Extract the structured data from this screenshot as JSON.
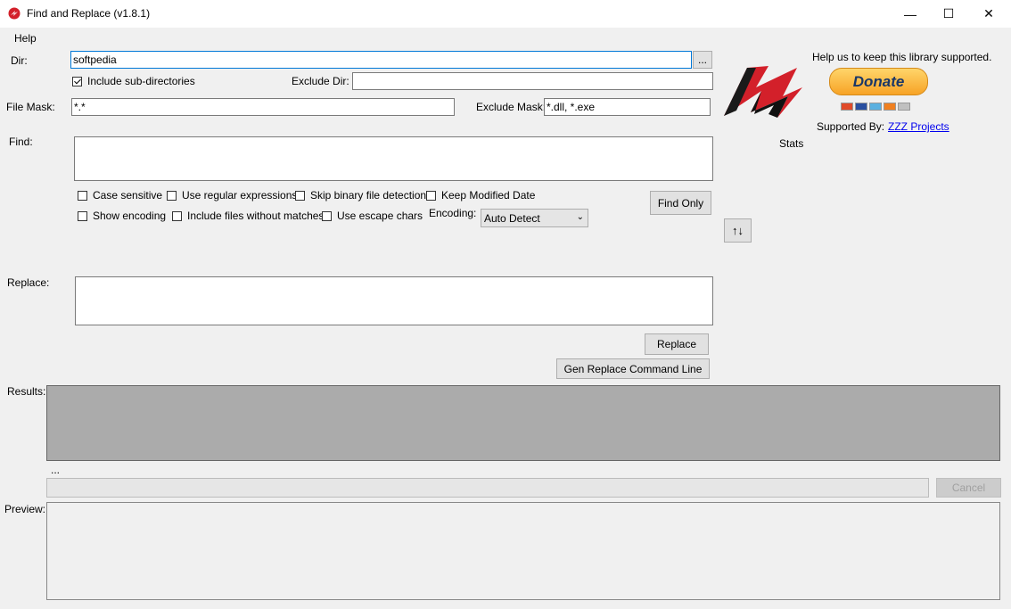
{
  "window": {
    "title": "Find and Replace (v1.8.1)",
    "controls": {
      "minimize": "—",
      "maximize": "☐",
      "close": "✕"
    }
  },
  "menu": {
    "items": [
      "Help"
    ]
  },
  "dir": {
    "label": "Dir:",
    "value": "softpedia",
    "browse_label": "..."
  },
  "include_subdirs": {
    "label": "Include sub-directories",
    "checked": true
  },
  "exclude_dir": {
    "label": "Exclude Dir:",
    "value": ""
  },
  "file_mask": {
    "label": "File Mask:",
    "value": "*.*"
  },
  "exclude_mask": {
    "label": "Exclude Mask:",
    "value": "*.dll, *.exe"
  },
  "find": {
    "label": "Find:",
    "value": ""
  },
  "options": {
    "case_sensitive": {
      "label": "Case sensitive",
      "checked": false
    },
    "regex": {
      "label": "Use regular expressions",
      "checked": false
    },
    "skip_binary": {
      "label": "Skip binary file detection",
      "checked": false
    },
    "keep_modified": {
      "label": "Keep Modified Date",
      "checked": false
    },
    "show_encoding": {
      "label": "Show encoding",
      "checked": false
    },
    "include_no_match": {
      "label": "Include files without matches",
      "checked": false
    },
    "escape_chars": {
      "label": "Use escape chars",
      "checked": false
    }
  },
  "encoding": {
    "label": "Encoding:",
    "selected": "Auto Detect"
  },
  "buttons": {
    "find_only": "Find Only",
    "swap": "↑↓",
    "replace": "Replace",
    "gen_cmd": "Gen Replace Command Line",
    "cancel": "Cancel"
  },
  "replace": {
    "label": "Replace:",
    "value": ""
  },
  "results": {
    "label": "Results:",
    "status": "..."
  },
  "preview": {
    "label": "Preview:"
  },
  "support": {
    "message": "Help us to keep this library supported.",
    "donate_label": "Donate",
    "supported_by_label": "Supported By:",
    "supported_by_link": "ZZZ Projects",
    "stats_label": "Stats"
  },
  "colors": {
    "accent": "#0078d7",
    "logo_red": "#d3202a",
    "link": "#0000ee"
  }
}
